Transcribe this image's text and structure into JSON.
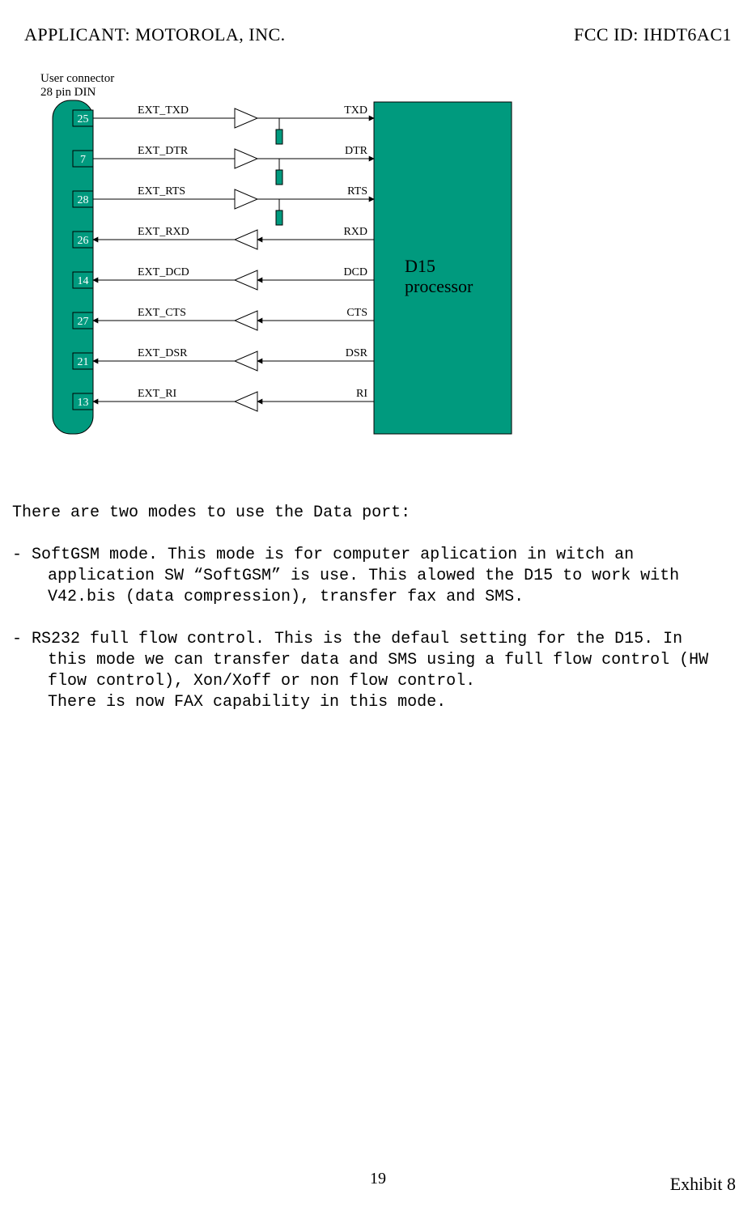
{
  "header": {
    "applicant": "APPLICANT:  MOTOROLA, INC.",
    "fcc_id": "FCC ID: IHDT6AC1"
  },
  "diagram": {
    "connector_label_l1": "User connector",
    "connector_label_l2": "28 pin DIN",
    "processor_l1": "D15",
    "processor_l2": "processor",
    "signals": [
      {
        "pin": "25",
        "ext": "EXT_TXD",
        "sig": "TXD",
        "dir": "out",
        "variant": "split"
      },
      {
        "pin": "7",
        "ext": "EXT_DTR",
        "sig": "DTR",
        "dir": "out",
        "variant": "split"
      },
      {
        "pin": "28",
        "ext": "EXT_RTS",
        "sig": "RTS",
        "dir": "out",
        "variant": "split"
      },
      {
        "pin": "26",
        "ext": "EXT_RXD",
        "sig": "RXD",
        "dir": "in",
        "variant": "buf"
      },
      {
        "pin": "14",
        "ext": "EXT_DCD",
        "sig": "DCD",
        "dir": "in",
        "variant": "buf"
      },
      {
        "pin": "27",
        "ext": "EXT_CTS",
        "sig": "CTS",
        "dir": "in",
        "variant": "buf"
      },
      {
        "pin": "21",
        "ext": "EXT_DSR",
        "sig": "DSR",
        "dir": "in",
        "variant": "buf"
      },
      {
        "pin": "13",
        "ext": "EXT_RI",
        "sig": "RI",
        "dir": "in",
        "variant": "buf"
      }
    ]
  },
  "body": {
    "intro": "There are two modes to use the Data  port:",
    "item1": "-  SoftGSM mode. This mode is for computer aplication in witch an application SW “SoftGSM” is use. This alowed the D15 to work  with V42.bis (data compression), transfer fax and SMS.",
    "item2a": "-  RS232 full flow control. This is the defaul setting for the D15. In this mode we can transfer data and SMS using a full flow control (HW flow control), Xon/Xoff or non flow control.",
    "item2b": "There is now FAX capability in this mode."
  },
  "footer": {
    "page_number": "19",
    "exhibit": "Exhibit 8"
  },
  "colors": {
    "block_fill": "#009a7e",
    "stroke": "#000000"
  }
}
